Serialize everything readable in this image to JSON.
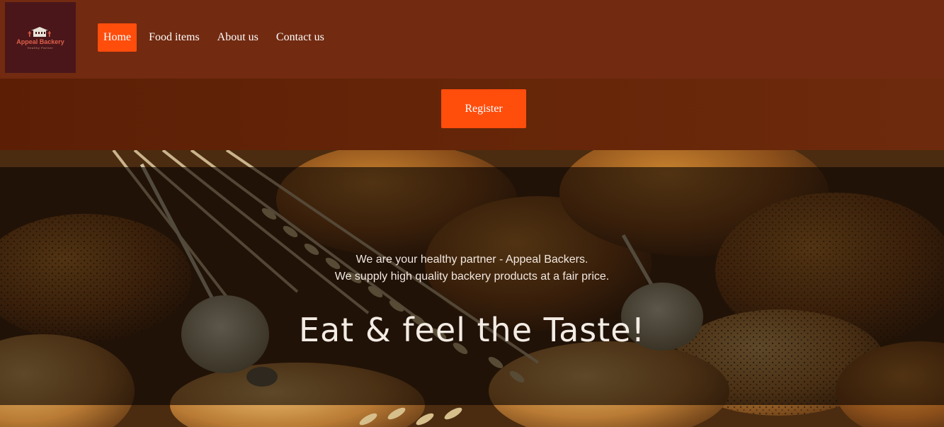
{
  "logo": {
    "name": "Appeal Backery",
    "tagline": "Healthy Partner"
  },
  "nav": {
    "items": [
      {
        "label": "Home",
        "active": true
      },
      {
        "label": "Food items",
        "active": false
      },
      {
        "label": "About us",
        "active": false
      },
      {
        "label": "Contact us",
        "active": false
      }
    ]
  },
  "register": {
    "label": "Register"
  },
  "hero": {
    "line1": "We are your healthy partner - Appeal Backers.",
    "line2": "We supply high quality backery products at a fair price.",
    "headline": "Eat & feel the Taste!"
  },
  "colors": {
    "navbar": "#722a10",
    "accent": "#ff4d0c",
    "logo_bg": "#4a161a",
    "band": "#652508"
  }
}
